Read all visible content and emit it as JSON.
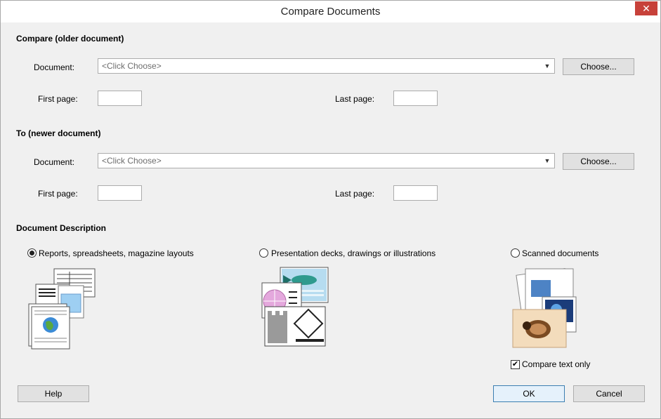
{
  "window": {
    "title": "Compare Documents",
    "close_glyph": "✕"
  },
  "older": {
    "heading": "Compare (older document)",
    "document_label": "Document:",
    "document_value": "<Click Choose>",
    "choose_label": "Choose...",
    "first_page_label": "First page:",
    "last_page_label": "Last page:"
  },
  "newer": {
    "heading": "To (newer document)",
    "document_label": "Document:",
    "document_value": "<Click Choose>",
    "choose_label": "Choose...",
    "first_page_label": "First page:",
    "last_page_label": "Last page:"
  },
  "description": {
    "heading": "Document Description",
    "options": [
      {
        "label": "Reports, spreadsheets, magazine layouts",
        "checked": true,
        "icon": "reports-illustration-icon"
      },
      {
        "label": "Presentation decks, drawings or illustrations",
        "checked": false,
        "icon": "presentation-illustration-icon"
      },
      {
        "label": "Scanned documents",
        "checked": false,
        "icon": "scanned-documents-illustration-icon"
      }
    ],
    "compare_text_only_label": "Compare text only",
    "compare_text_only_checked": true,
    "check_glyph": "✔"
  },
  "footer": {
    "help_label": "Help",
    "ok_label": "OK",
    "cancel_label": "Cancel"
  }
}
